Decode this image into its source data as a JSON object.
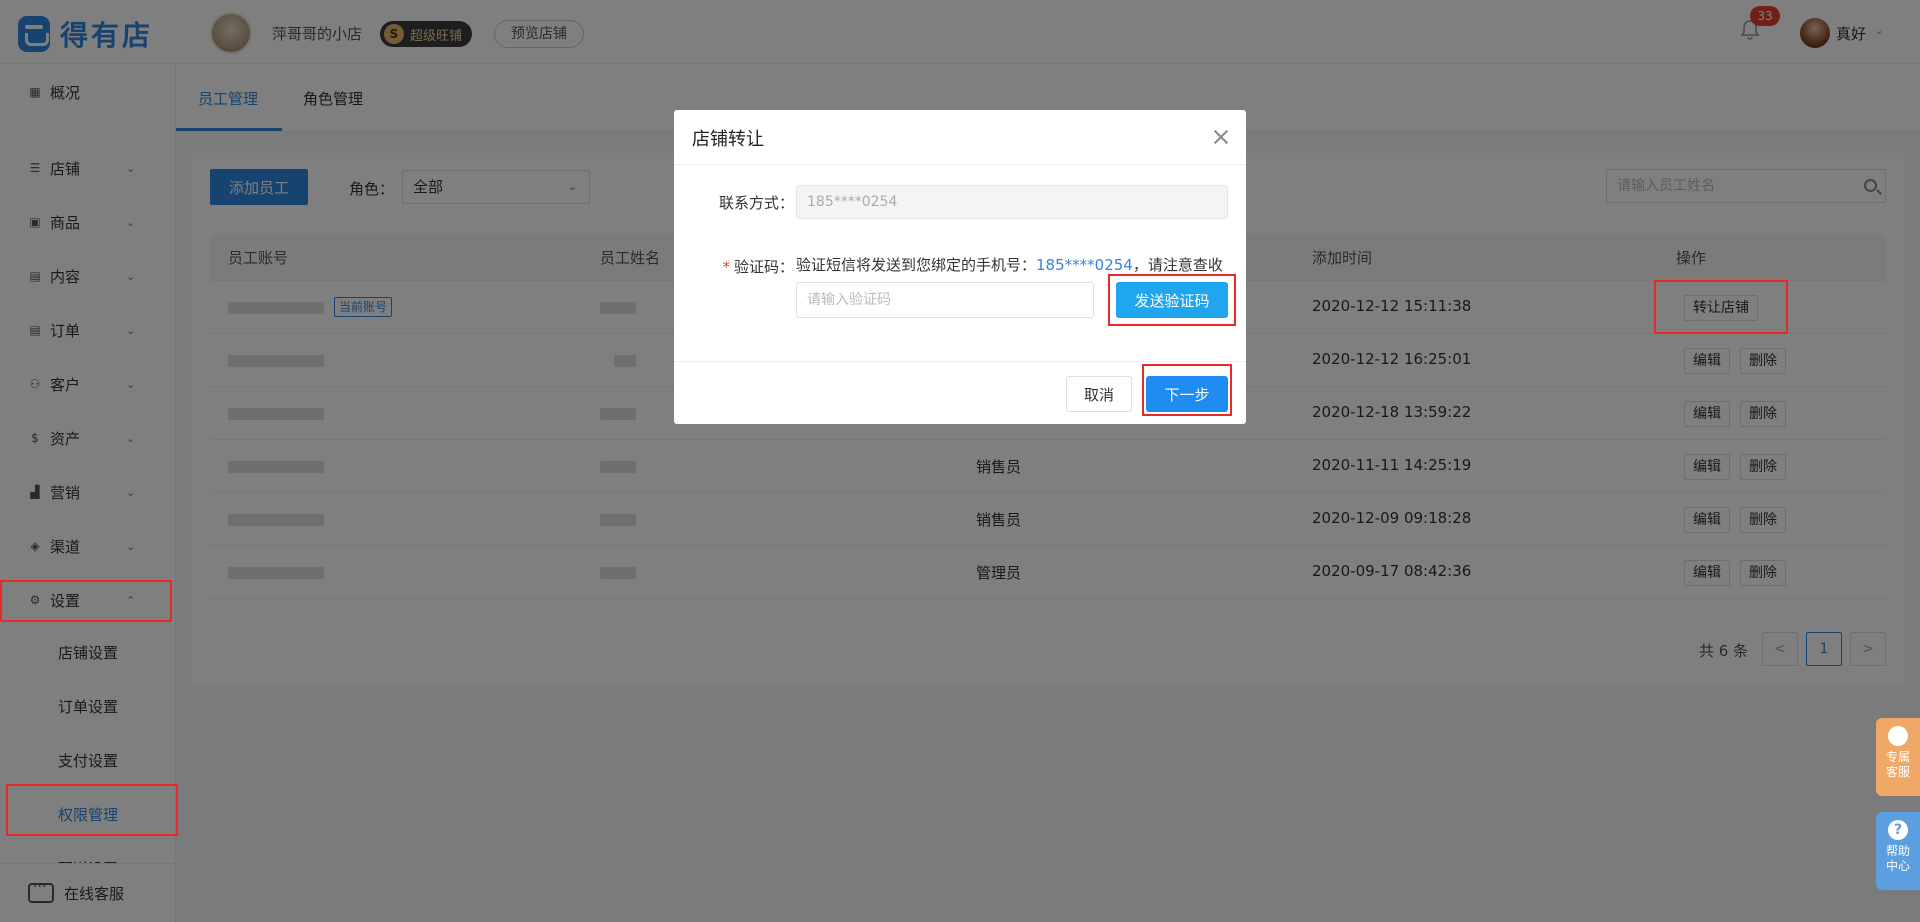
{
  "header": {
    "logo_text": "得有店",
    "shop_name": "萍哥哥的小店",
    "vip_label": "超级旺铺",
    "vip_icon": "S",
    "preview_label": "预览店铺",
    "notification_count": "33",
    "user_name": "真好",
    "user_chevron": "⌄"
  },
  "sidebar": {
    "items": [
      {
        "label": "概况",
        "icon": "grid-icon"
      },
      {
        "label": "店铺",
        "icon": "sliders-icon"
      },
      {
        "label": "商品",
        "icon": "box-icon"
      },
      {
        "label": "内容",
        "icon": "document-icon"
      },
      {
        "label": "订单",
        "icon": "list-icon"
      },
      {
        "label": "客户",
        "icon": "users-icon"
      },
      {
        "label": "资产",
        "icon": "dollar-icon"
      },
      {
        "label": "营销",
        "icon": "bar-chart-icon"
      },
      {
        "label": "渠道",
        "icon": "layers-icon"
      },
      {
        "label": "设置",
        "icon": "gear-icon"
      }
    ],
    "sub_items": [
      {
        "label": "店铺设置"
      },
      {
        "label": "订单设置"
      },
      {
        "label": "支付设置"
      },
      {
        "label": "权限管理"
      },
      {
        "label": "配送设置"
      }
    ],
    "footer_label": "在线客服"
  },
  "tabs": [
    {
      "label": "员工管理"
    },
    {
      "label": "角色管理"
    }
  ],
  "toolbar": {
    "add_label": "添加员工",
    "role_label": "角色：",
    "role_value": "全部",
    "search_placeholder": "请输入员工姓名"
  },
  "table": {
    "columns": [
      "员工账号",
      "员工姓名",
      "添加时间",
      "操作"
    ],
    "current_tag": "当前账号",
    "rows": [
      {
        "role": "",
        "time": "2020-12-12 15:11:38",
        "ops": [
          "转让店铺"
        ]
      },
      {
        "role": "",
        "time": "2020-12-12 16:25:01",
        "ops": [
          "编辑",
          "删除"
        ]
      },
      {
        "role": "",
        "time": "2020-12-18 13:59:22",
        "ops": [
          "编辑",
          "删除"
        ]
      },
      {
        "role": "销售员",
        "time": "2020-11-11 14:25:19",
        "ops": [
          "编辑",
          "删除"
        ]
      },
      {
        "role": "销售员",
        "time": "2020-12-09 09:18:28",
        "ops": [
          "编辑",
          "删除"
        ]
      },
      {
        "role": "管理员",
        "time": "2020-09-17 08:42:36",
        "ops": [
          "编辑",
          "删除"
        ]
      }
    ]
  },
  "pagination": {
    "total_label": "共 6 条",
    "prev": "<",
    "page": "1",
    "next": ">"
  },
  "modal": {
    "title": "店铺转让",
    "contact_label": "联系方式：",
    "contact_value": "185****0254",
    "code_required_mark": "*",
    "code_label": "验证码：",
    "hint_prefix": "验证短信将发送到您绑定的手机号：",
    "hint_phone": "185****0254",
    "hint_suffix": "，请注意查收",
    "code_placeholder": "请输入验证码",
    "send_label": "发送验证码",
    "cancel_label": "取消",
    "next_label": "下一步"
  },
  "floating": {
    "cs_label_1": "专属",
    "cs_label_2": "客服",
    "help_icon": "?",
    "help_label_1": "帮助",
    "help_label_2": "中心"
  },
  "colors": {
    "primary": "#2f86e0",
    "annotation_red": "#e62a2a",
    "send_button": "#1fa6ef",
    "badge_red": "#e5412f"
  }
}
